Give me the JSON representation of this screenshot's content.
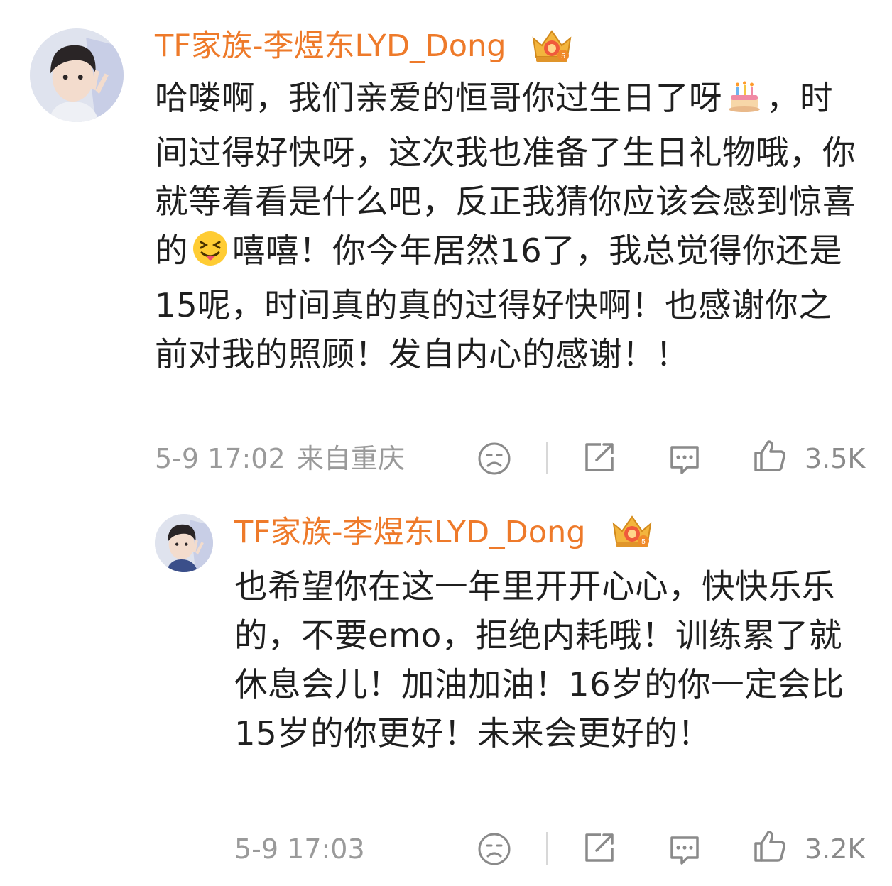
{
  "comment": {
    "author": "TF家族-李煜东LYD_Dong",
    "text_before_cake": "哈喽啊，我们亲爱的恒哥你过生日了呀",
    "text_after_cake": "，时间过得好快呀，这次我也准备了生日礼物哦，你就等着看是什么吧，反正我猜你应该会感到惊喜的",
    "text_after_wink": "嘻嘻！你今年居然16了，我总觉得你还是15呢，时间真的真的过得好快啊！也感谢你之前对我的照顾！发自内心的感谢！！",
    "timestamp": "5-9 17:02",
    "location": "来自重庆",
    "likes": "3.5K"
  },
  "reply": {
    "author": "TF家族-李煜东LYD_Dong",
    "text": "也希望你在这一年里开开心心，快快乐乐的，不要emo，拒绝内耗哦！训练累了就休息会儿！加油加油！16岁的你一定会比15岁的你更好！未来会更好的！",
    "timestamp": "5-9 17:03",
    "likes": "3.2K"
  },
  "icons": {
    "badge": "crown-badge-icon",
    "cake": "cake-emoji-icon",
    "wink": "squint-tongue-emoji-icon",
    "dislike": "frown-face-icon",
    "share": "share-icon",
    "reply": "comment-bubble-icon",
    "like": "thumbs-up-icon"
  },
  "colors": {
    "username": "#ee7a2a",
    "meta": "#9a9a9a",
    "body": "#1f1f1f"
  }
}
